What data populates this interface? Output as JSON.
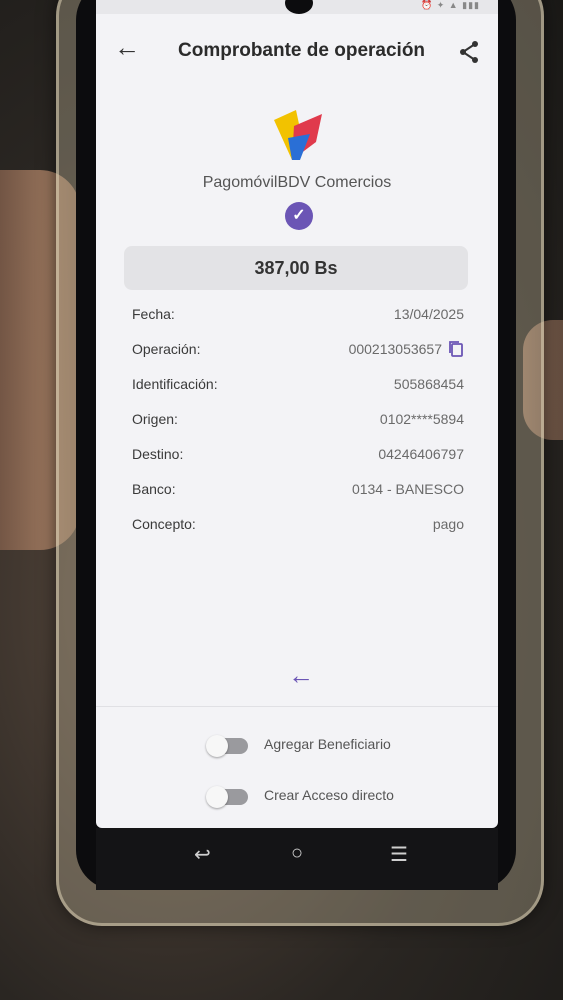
{
  "header": {
    "title": "Comprobante de operación",
    "back_icon": "arrow-left-icon",
    "share_icon": "share-icon"
  },
  "brand": {
    "name": "PagomóvilBDV Comercios",
    "colors": [
      "#f2c200",
      "#2a6fd6",
      "#e03a4c"
    ]
  },
  "verified_icon": "check-circle-icon",
  "amount": "387,00 Bs",
  "details": [
    {
      "label": "Fecha:",
      "value": "13/04/2025"
    },
    {
      "label": "Operación:",
      "value": "000213053657"
    },
    {
      "label": "Identificación:",
      "value": "505868454"
    },
    {
      "label": "Origen:",
      "value": "0102****5894"
    },
    {
      "label": "Destino:",
      "value": "04246406797"
    },
    {
      "label": "Banco:",
      "value": "0134 - BANESCO"
    },
    {
      "label": "Concepto:",
      "value": "pago"
    }
  ],
  "toggles": [
    {
      "label": "Agregar Beneficiario",
      "on": false
    },
    {
      "label": "Crear Acceso directo",
      "on": false
    }
  ],
  "accent_color": "#6b55b5"
}
